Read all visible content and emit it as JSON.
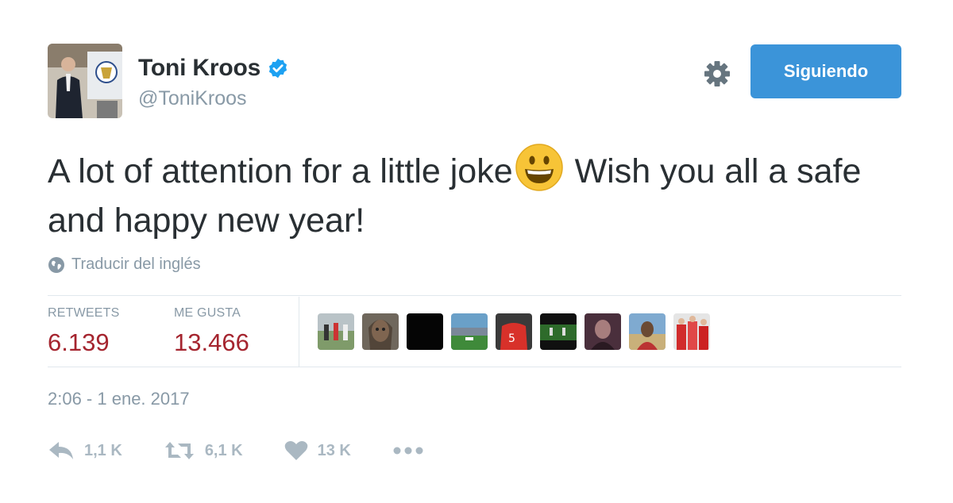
{
  "user": {
    "display_name": "Toni Kroos",
    "handle": "@ToniKroos",
    "verified_icon": "verified-badge-icon"
  },
  "header": {
    "settings_icon": "gear-icon",
    "follow_label": "Siguiendo",
    "follow_color": "#3b94d9"
  },
  "tweet": {
    "text_before_emoji": "A lot of attention for a little joke",
    "emoji": "smiley-emoji",
    "text_after_emoji": " Wish you all a safe and happy new year!",
    "translate_label": "Traducir del inglés",
    "timestamp": "2:06 - 1 ene. 2017"
  },
  "stats": {
    "retweets_label": "RETWEETS",
    "retweets_value": "6.139",
    "likes_label": "ME GUSTA",
    "likes_value": "13.466",
    "value_color": "#a5252f"
  },
  "likers_count": 9,
  "actions": {
    "reply_count": "1,1 K",
    "retweet_count": "6,1 K",
    "like_count": "13 K",
    "more_icon": "more-dots-icon"
  }
}
